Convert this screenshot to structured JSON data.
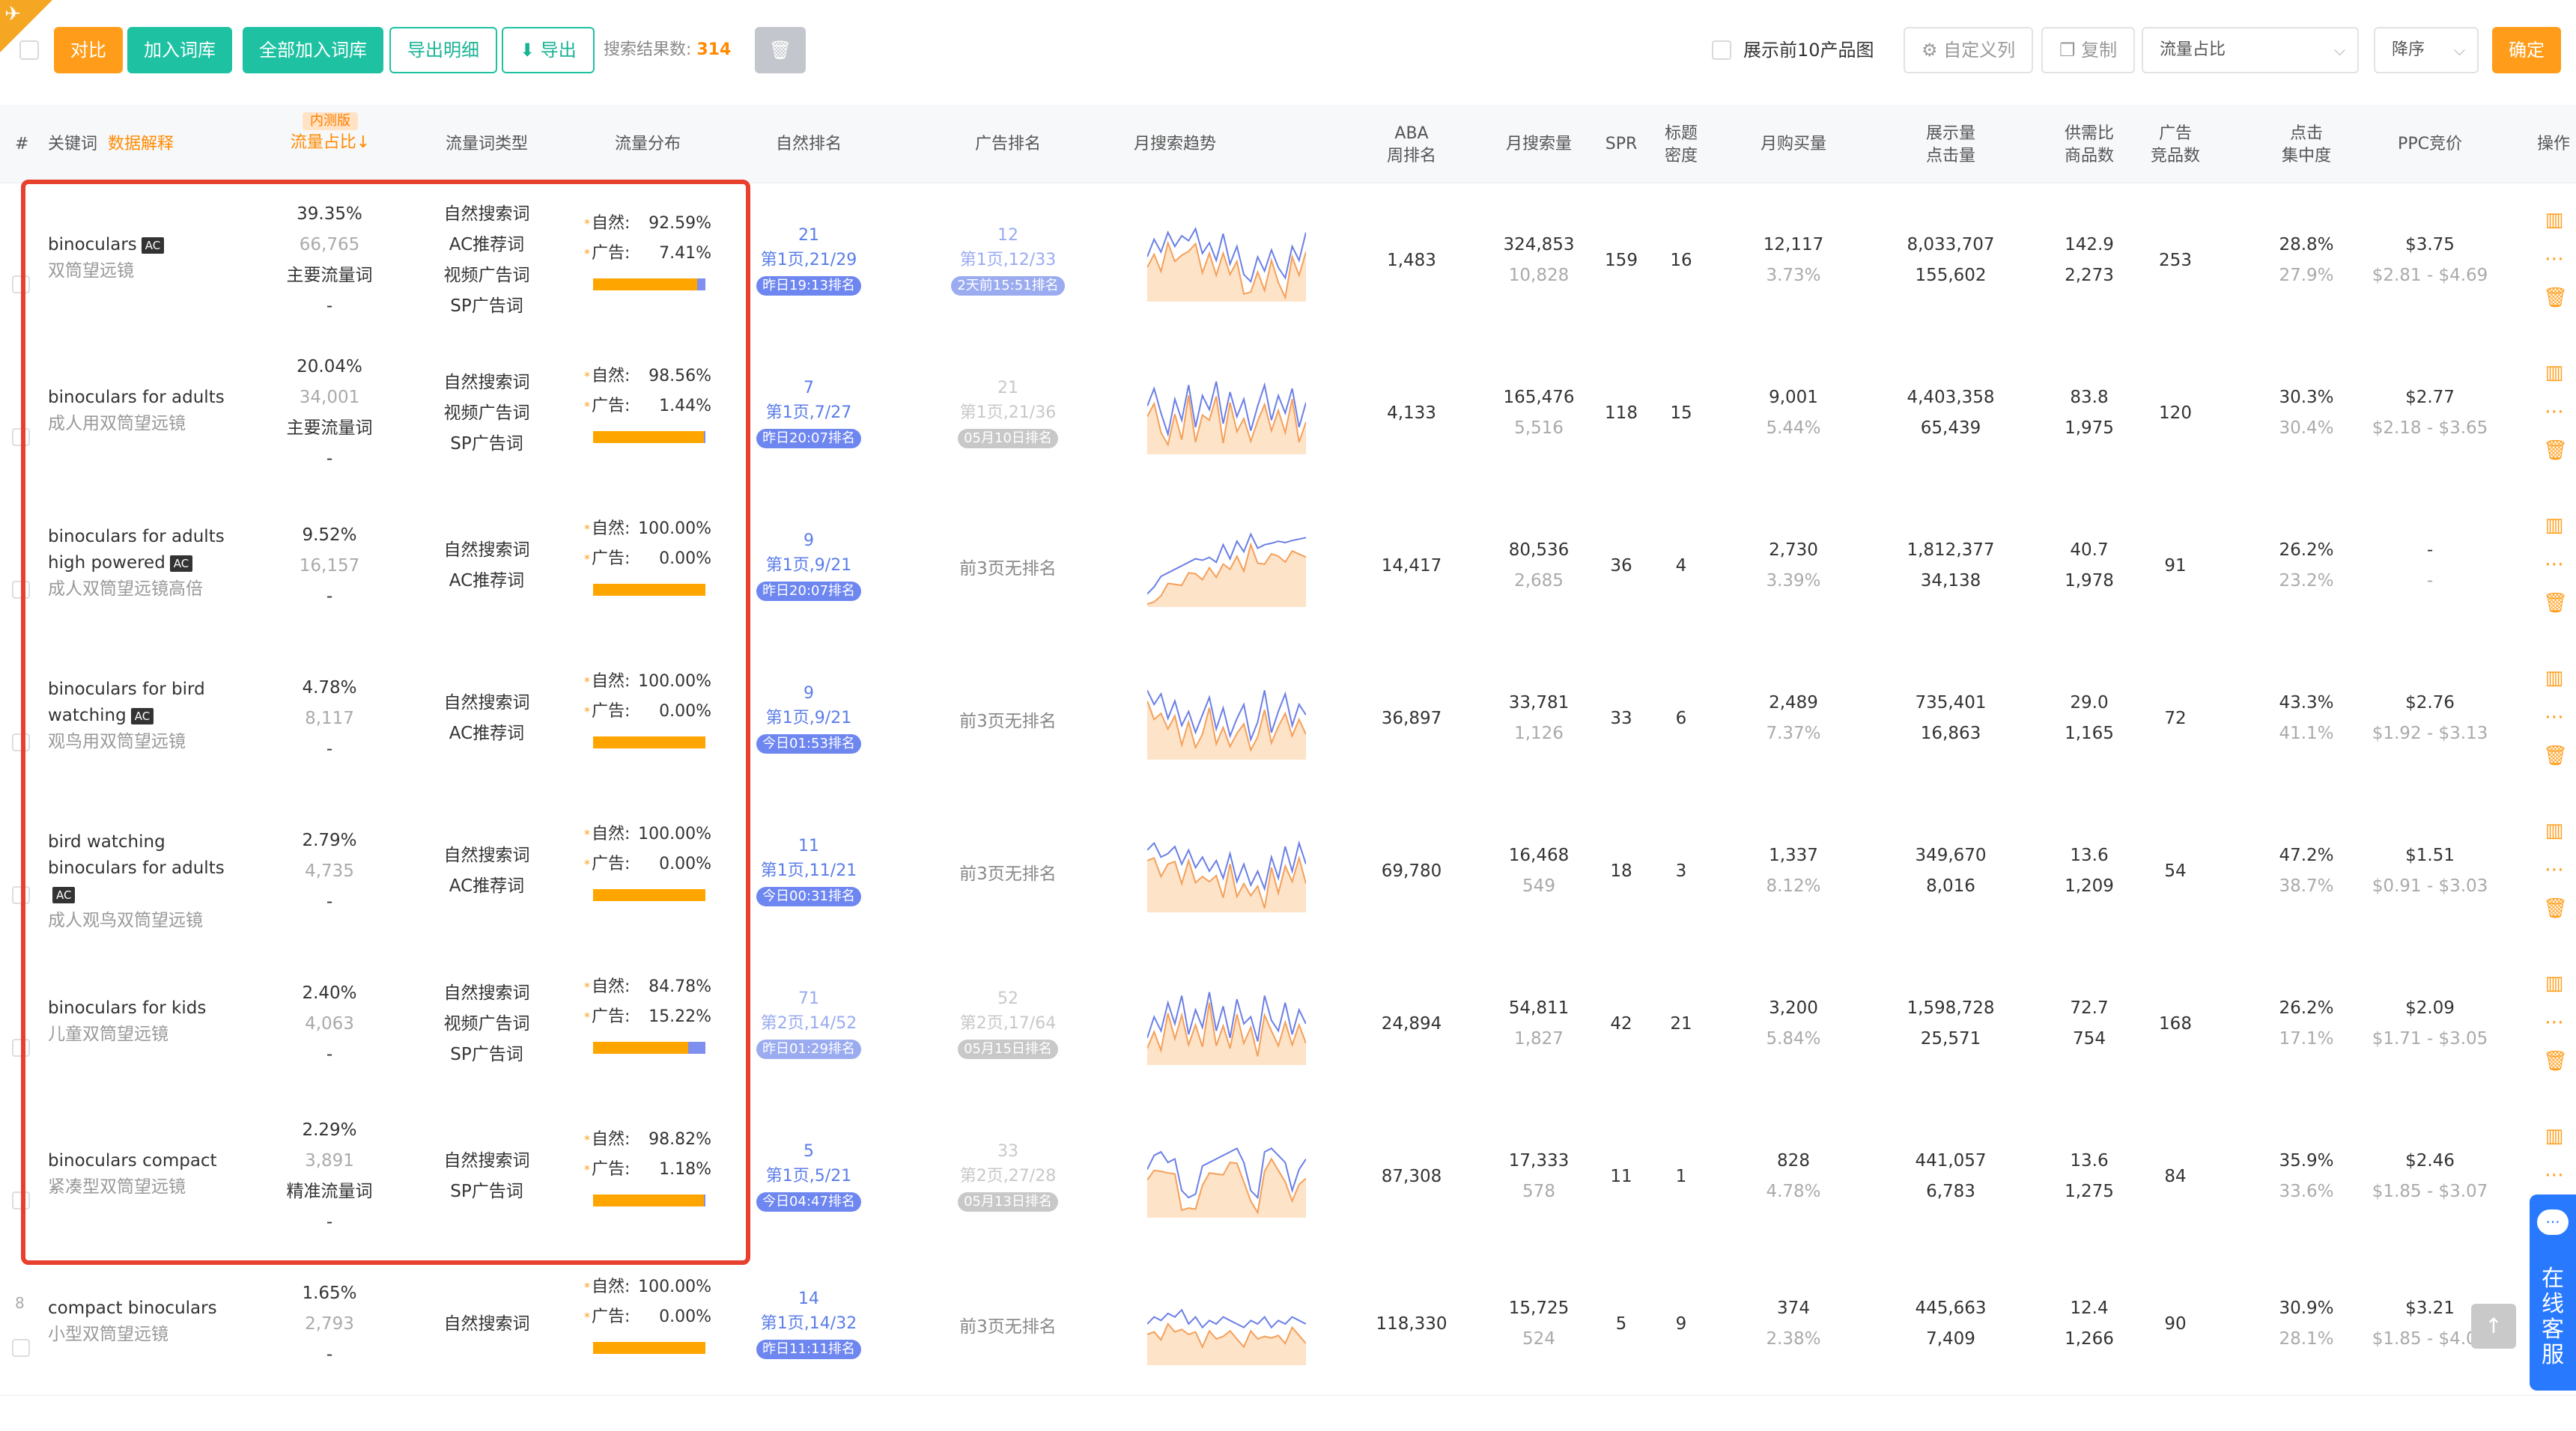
{
  "toolbar": {
    "compare": "对比",
    "add_to_lib": "加入词库",
    "add_all": "全部加入词库",
    "export_detail": "导出明细",
    "export": "导出",
    "result_label": "搜索结果数:",
    "result_count": "314",
    "show_top10": "展示前10产品图",
    "custom_cols": "自定义列",
    "copy": "复制",
    "sort_field": "流量占比",
    "sort_order": "降序",
    "confirm": "确定"
  },
  "columns": {
    "index": "#",
    "keyword": "关键词",
    "keyword_note": "数据解释",
    "beta": "内测版",
    "traffic_share": "流量占比↓",
    "traffic_type": "流量词类型",
    "traffic_dist": "流量分布",
    "organic_rank": "自然排名",
    "ad_rank": "广告排名",
    "trend": "月搜索趋势",
    "aba_1": "ABA",
    "aba_2": "周排名",
    "monthly_search": "月搜索量",
    "spr": "SPR",
    "title_1": "标题",
    "title_2": "密度",
    "monthly_buy": "月购买量",
    "display_1": "展示量",
    "display_2": "点击量",
    "supply_1": "供需比",
    "supply_2": "商品数",
    "ad_1": "广告",
    "ad_2": "竞品数",
    "click_1": "点击",
    "click_2": "集中度",
    "ppc": "PPC竞价",
    "ops": "操作"
  },
  "labels": {
    "organic": "自然:",
    "ad": "广告:",
    "no_rank": "前3页无排名"
  },
  "rows": [
    {
      "num": "",
      "kw": "binoculars",
      "ac": "AC",
      "zh": "双筒望远镜",
      "share": "39.35%",
      "share2": "66,765",
      "main": "主要流量词",
      "dash": "-",
      "types": [
        "自然搜索词",
        "AC推荐词",
        "视频广告词",
        "SP广告词"
      ],
      "organic_pct": "92.59%",
      "ad_pct": "7.41%",
      "fill": 0.926,
      "org_rank": {
        "n": "21",
        "page": "第1页,21/29",
        "tag": "昨日19:13排名"
      },
      "ad_rank": {
        "n": "12",
        "page": "第1页,12/33",
        "tag": "2天前15:51排名",
        "gray": false
      },
      "trend": [
        0.55,
        0.8,
        0.62,
        0.9,
        0.7,
        0.85,
        0.78,
        0.95,
        0.6,
        0.75,
        0.5,
        0.88,
        0.45,
        0.7,
        0.3,
        0.2,
        0.55,
        0.35,
        0.65,
        0.4,
        0.25,
        0.7,
        0.5,
        0.9
      ],
      "aba": "1,483",
      "ms": "324,853",
      "ms2": "10,828",
      "spr": "159",
      "td": "16",
      "mb": "12,117",
      "mb2": "3.73%",
      "disp": "8,033,707",
      "clk": "155,602",
      "sup": "142.9",
      "sup2": "2,273",
      "adc": "253",
      "cc": "28.8%",
      "cc2": "27.9%",
      "ppc": "$3.75",
      "ppc2": "$2.81 - $4.69"
    },
    {
      "num": "",
      "kw": "binoculars for adults",
      "ac": "",
      "zh": "成人用双筒望远镜",
      "share": "20.04%",
      "share2": "34,001",
      "main": "主要流量词",
      "dash": "-",
      "types": [
        "自然搜索词",
        "视频广告词",
        "SP广告词"
      ],
      "organic_pct": "98.56%",
      "ad_pct": "1.44%",
      "fill": 0.986,
      "org_rank": {
        "n": "7",
        "page": "第1页,7/27",
        "tag": "昨日20:07排名"
      },
      "ad_rank": {
        "n": "21",
        "page": "第1页,21/36",
        "tag": "05月10日排名",
        "gray": true
      },
      "trend": [
        0.6,
        0.85,
        0.5,
        0.2,
        0.7,
        0.4,
        0.9,
        0.3,
        0.75,
        0.55,
        0.95,
        0.35,
        0.8,
        0.45,
        0.7,
        0.25,
        0.6,
        0.9,
        0.4,
        0.75,
        0.5,
        0.85,
        0.3,
        0.65
      ],
      "aba": "4,133",
      "ms": "165,476",
      "ms2": "5,516",
      "spr": "118",
      "td": "15",
      "mb": "9,001",
      "mb2": "5.44%",
      "disp": "4,403,358",
      "clk": "65,439",
      "sup": "83.8",
      "sup2": "1,975",
      "adc": "120",
      "cc": "30.3%",
      "cc2": "30.4%",
      "ppc": "$2.77",
      "ppc2": "$2.18 - $3.65"
    },
    {
      "num": "",
      "kw": "binoculars for adults high powered",
      "ac": "AC",
      "zh": "成人双筒望远镜高倍",
      "share": "9.52%",
      "share2": "16,157",
      "main": "",
      "dash": "-",
      "types": [
        "自然搜索词",
        "AC推荐词"
      ],
      "organic_pct": "100.00%",
      "ad_pct": "0.00%",
      "fill": 1.0,
      "org_rank": {
        "n": "9",
        "page": "第1页,9/21",
        "tag": "昨日20:07排名"
      },
      "ad_rank": null,
      "trend": [
        0.1,
        0.2,
        0.35,
        0.4,
        0.45,
        0.5,
        0.55,
        0.6,
        0.58,
        0.62,
        0.55,
        0.8,
        0.6,
        0.85,
        0.7,
        0.95,
        0.75,
        0.8,
        0.82,
        0.85,
        0.83,
        0.86,
        0.88,
        0.9
      ],
      "aba": "14,417",
      "ms": "80,536",
      "ms2": "2,685",
      "spr": "36",
      "td": "4",
      "mb": "2,730",
      "mb2": "3.39%",
      "disp": "1,812,377",
      "clk": "34,138",
      "sup": "40.7",
      "sup2": "1,978",
      "adc": "91",
      "cc": "26.2%",
      "cc2": "23.2%",
      "ppc": "-",
      "ppc2": "-"
    },
    {
      "num": "",
      "kw": "binoculars for bird watching",
      "ac": "AC",
      "zh": "观鸟用双筒望远镜",
      "share": "4.78%",
      "share2": "8,117",
      "main": "",
      "dash": "-",
      "types": [
        "自然搜索词",
        "AC推荐词"
      ],
      "organic_pct": "100.00%",
      "ad_pct": "0.00%",
      "fill": 1.0,
      "org_rank": {
        "n": "9",
        "page": "第1页,9/21",
        "tag": "今日01:53排名"
      },
      "ad_rank": null,
      "trend": [
        0.9,
        0.7,
        0.85,
        0.5,
        0.75,
        0.4,
        0.6,
        0.3,
        0.55,
        0.8,
        0.35,
        0.65,
        0.25,
        0.5,
        0.7,
        0.2,
        0.45,
        0.9,
        0.3,
        0.6,
        0.85,
        0.4,
        0.7,
        0.55
      ],
      "aba": "36,897",
      "ms": "33,781",
      "ms2": "1,126",
      "spr": "33",
      "td": "6",
      "mb": "2,489",
      "mb2": "7.37%",
      "disp": "735,401",
      "clk": "16,863",
      "sup": "29.0",
      "sup2": "1,165",
      "adc": "72",
      "cc": "43.3%",
      "cc2": "41.1%",
      "ppc": "$2.76",
      "ppc2": "$1.92 - $3.13"
    },
    {
      "num": "",
      "kw": "bird watching binoculars for adults",
      "ac": "AC",
      "zh": "成人观鸟双筒望远镜",
      "share": "2.79%",
      "share2": "4,735",
      "main": "",
      "dash": "-",
      "types": [
        "自然搜索词",
        "AC推荐词"
      ],
      "organic_pct": "100.00%",
      "ad_pct": "0.00%",
      "fill": 1.0,
      "org_rank": {
        "n": "11",
        "page": "第1页,11/21",
        "tag": "今日00:31排名"
      },
      "ad_rank": null,
      "trend": [
        0.8,
        0.9,
        0.7,
        0.75,
        0.85,
        0.6,
        0.8,
        0.55,
        0.7,
        0.5,
        0.65,
        0.4,
        0.75,
        0.35,
        0.6,
        0.3,
        0.5,
        0.25,
        0.7,
        0.4,
        0.85,
        0.5,
        0.9,
        0.6
      ],
      "aba": "69,780",
      "ms": "16,468",
      "ms2": "549",
      "spr": "18",
      "td": "3",
      "mb": "1,337",
      "mb2": "8.12%",
      "disp": "349,670",
      "clk": "8,016",
      "sup": "13.6",
      "sup2": "1,209",
      "adc": "54",
      "cc": "47.2%",
      "cc2": "38.7%",
      "ppc": "$1.51",
      "ppc2": "$0.91 - $3.03"
    },
    {
      "num": "",
      "kw": "binoculars for kids",
      "ac": "",
      "zh": "儿童双筒望远镜",
      "share": "2.40%",
      "share2": "4,063",
      "main": "",
      "dash": "-",
      "types": [
        "自然搜索词",
        "视频广告词",
        "SP广告词"
      ],
      "organic_pct": "84.78%",
      "ad_pct": "15.22%",
      "fill": 0.848,
      "org_rank": {
        "n": "71",
        "page": "第2页,14/52",
        "tag": "昨日01:29排名",
        "gray": false,
        "light": true
      },
      "ad_rank": {
        "n": "52",
        "page": "第2页,17/64",
        "tag": "05月15日排名",
        "gray": true
      },
      "trend": [
        0.3,
        0.6,
        0.4,
        0.8,
        0.5,
        0.9,
        0.35,
        0.7,
        0.45,
        0.95,
        0.4,
        0.75,
        0.3,
        0.85,
        0.5,
        0.6,
        0.25,
        0.9,
        0.55,
        0.4,
        0.8,
        0.35,
        0.7,
        0.5
      ],
      "aba": "24,894",
      "ms": "54,811",
      "ms2": "1,827",
      "spr": "42",
      "td": "21",
      "mb": "3,200",
      "mb2": "5.84%",
      "disp": "1,598,728",
      "clk": "25,571",
      "sup": "72.7",
      "sup2": "754",
      "adc": "168",
      "cc": "26.2%",
      "cc2": "17.1%",
      "ppc": "$2.09",
      "ppc2": "$1.71 - $3.05"
    },
    {
      "num": "",
      "kw": "binoculars compact",
      "ac": "",
      "zh": "紧凑型双筒望远镜",
      "share": "2.29%",
      "share2": "3,891",
      "main": "精准流量词",
      "dash": "-",
      "types": [
        "自然搜索词",
        "SP广告词"
      ],
      "organic_pct": "98.82%",
      "ad_pct": "1.18%",
      "fill": 0.988,
      "org_rank": {
        "n": "5",
        "page": "第1页,5/21",
        "tag": "今日04:47排名"
      },
      "ad_rank": {
        "n": "33",
        "page": "第2页,27/28",
        "tag": "05月13日排名",
        "gray": true
      },
      "trend": [
        0.6,
        0.8,
        0.85,
        0.7,
        0.75,
        0.3,
        0.2,
        0.25,
        0.65,
        0.7,
        0.75,
        0.8,
        0.85,
        0.9,
        0.7,
        0.3,
        0.2,
        0.85,
        0.9,
        0.8,
        0.7,
        0.3,
        0.6,
        0.75
      ],
      "aba": "87,308",
      "ms": "17,333",
      "ms2": "578",
      "spr": "11",
      "td": "1",
      "mb": "828",
      "mb2": "4.78%",
      "disp": "441,057",
      "clk": "6,783",
      "sup": "13.6",
      "sup2": "1,275",
      "adc": "84",
      "cc": "35.9%",
      "cc2": "33.6%",
      "ppc": "$2.46",
      "ppc2": "$1.85 - $3.07"
    },
    {
      "num": "8",
      "kw": "compact binoculars",
      "ac": "",
      "zh": "小型双筒望远镜",
      "share": "1.65%",
      "share2": "2,793",
      "main": "",
      "dash": "-",
      "types": [
        "自然搜索词"
      ],
      "organic_pct": "100.00%",
      "ad_pct": "0.00%",
      "fill": 1.0,
      "org_rank": {
        "n": "14",
        "page": "第1页,14/32",
        "tag": "昨日11:11排名"
      },
      "ad_rank": null,
      "trend": [
        0.5,
        0.6,
        0.55,
        0.65,
        0.6,
        0.7,
        0.5,
        0.6,
        0.45,
        0.55,
        0.5,
        0.6,
        0.55,
        0.5,
        0.45,
        0.55,
        0.5,
        0.6,
        0.45,
        0.55,
        0.5,
        0.6,
        0.55,
        0.5
      ],
      "aba": "118,330",
      "ms": "15,725",
      "ms2": "524",
      "spr": "5",
      "td": "9",
      "mb": "374",
      "mb2": "2.38%",
      "disp": "445,663",
      "clk": "7,409",
      "sup": "12.4",
      "sup2": "1,266",
      "adc": "90",
      "cc": "30.9%",
      "cc2": "28.1%",
      "ppc": "$3.21",
      "ppc2": "$1.85 - $4.07"
    }
  ],
  "support": {
    "text": "在线客服",
    "bubble": "···"
  },
  "icons": {
    "corner": "pin-icon",
    "chart": "bar-chart-icon",
    "more": "more-icon",
    "trash": "trash-icon",
    "back_top": "arrow-up-icon"
  },
  "colors": {
    "accent": "#ff9d1a",
    "teal": "#1ec2a2",
    "blue": "#5b7de8",
    "highlight": "#e8402f"
  }
}
